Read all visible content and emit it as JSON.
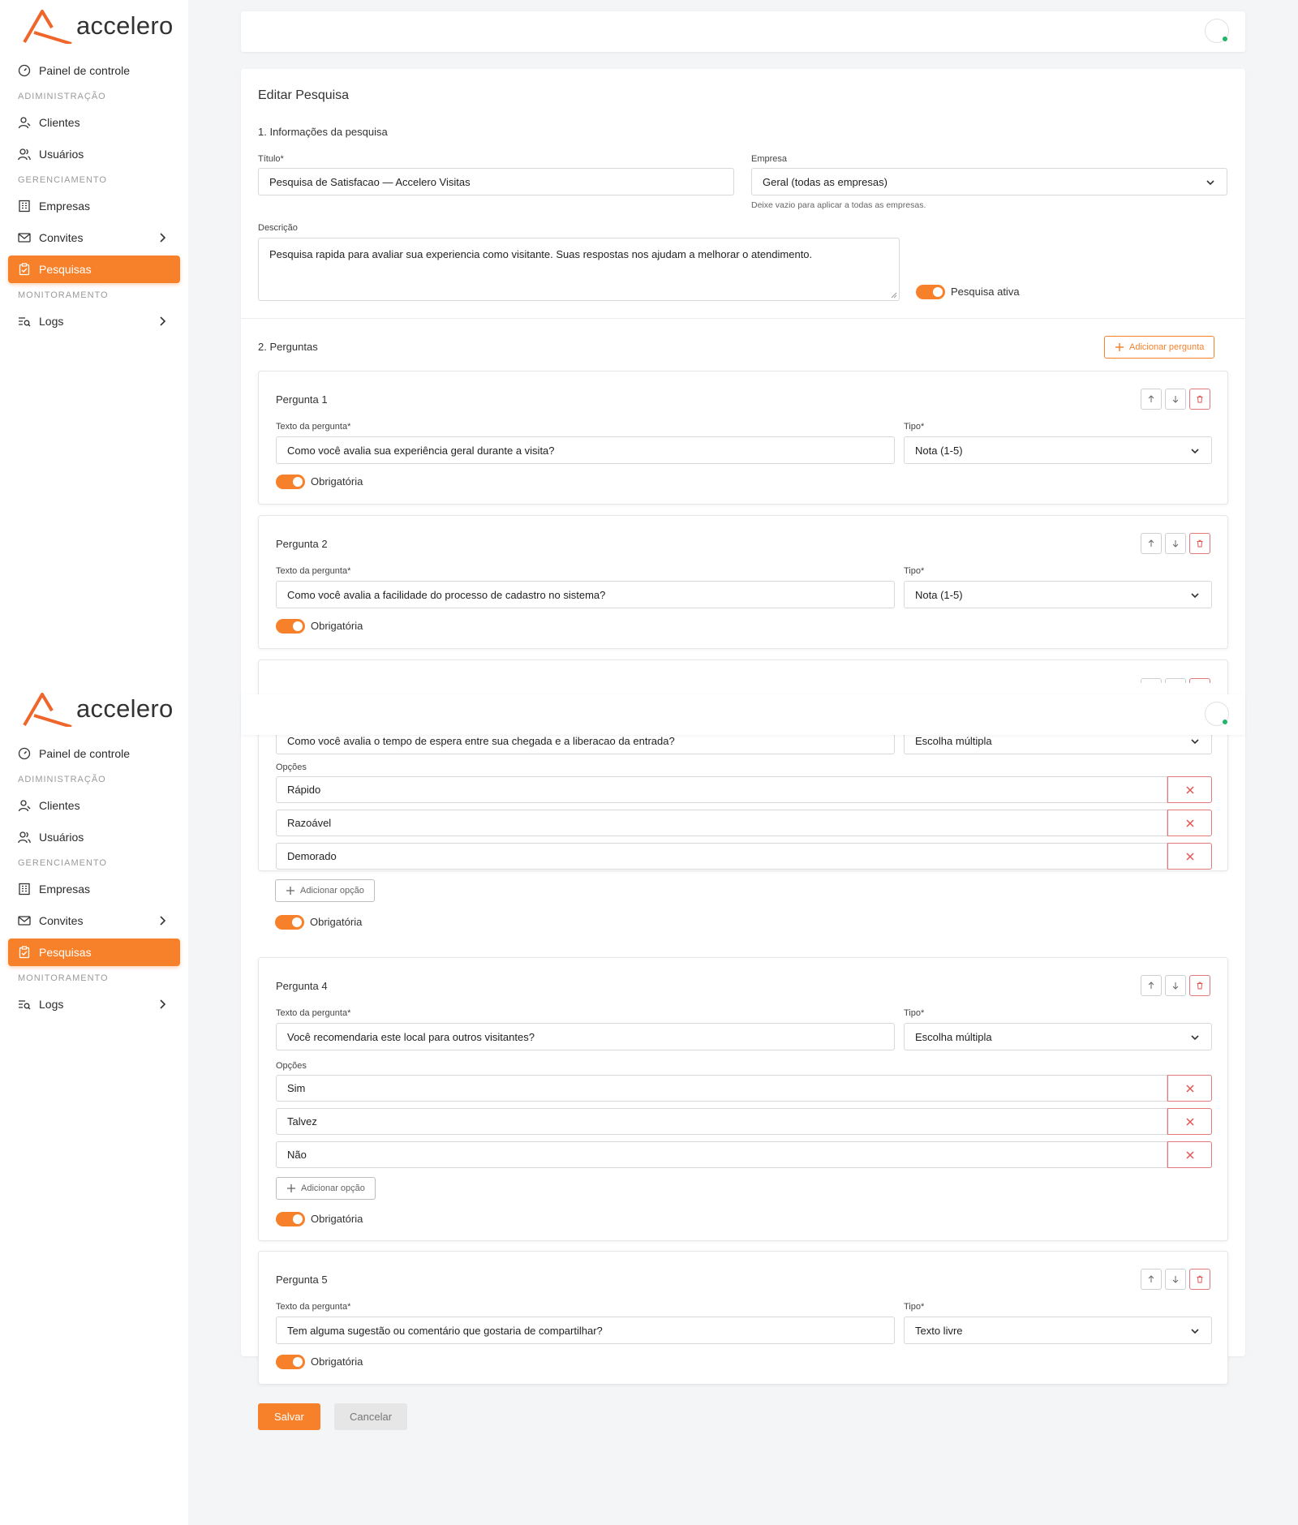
{
  "brand": {
    "name": "accelero",
    "accent": "#f7812b"
  },
  "nav": {
    "dashboard": "Painel de controle",
    "sec_admin": "ADIMINISTRAÇÃO",
    "clients": "Clientes",
    "users": "Usuários",
    "sec_manage": "GERENCIAMENTO",
    "companies": "Empresas",
    "invites": "Convites",
    "surveys": "Pesquisas",
    "sec_monitor": "MONITORAMENTO",
    "logs": "Logs"
  },
  "form": {
    "page_title": "Editar Pesquisa",
    "section1": "1. Informações da pesquisa",
    "title_label": "Título*",
    "title_value": "Pesquisa de Satisfacao — Accelero Visitas",
    "company_label": "Empresa",
    "company_value": "Geral (todas as empresas)",
    "company_help": "Deixe vazio para aplicar a todas as empresas.",
    "desc_label": "Descrição",
    "desc_value": "Pesquisa rapida para avaliar sua experiencia como visitante. Suas respostas nos ajudam a melhorar o atendimento.",
    "active_label": "Pesquisa ativa",
    "section2": "2. Perguntas",
    "add_question": "Adicionar pergunta"
  },
  "common": {
    "text_label": "Texto da pergunta*",
    "type_label": "Tipo*",
    "options_label": "Opções",
    "add_option": "Adicionar opção",
    "required": "Obrigatória"
  },
  "questions": [
    {
      "title": "Pergunta 1",
      "text": "Como você avalia sua experiência geral durante a visita?",
      "type": "Nota (1-5)",
      "required": true
    },
    {
      "title": "Pergunta 2",
      "text": "Como você avalia a facilidade do processo de cadastro no sistema?",
      "type": "Nota (1-5)",
      "required": true
    },
    {
      "text": "Como você avalia o tempo de espera entre sua chegada e a liberacao da entrada?",
      "type": "Escolha múltipla",
      "options": [
        "Rápido",
        "Razoável",
        "Demorado"
      ],
      "required": true
    },
    {
      "title": "Pergunta 4",
      "text": "Você recomendaria este local para outros visitantes?",
      "type": "Escolha múltipla",
      "options": [
        "Sim",
        "Talvez",
        "Não"
      ],
      "required": true
    },
    {
      "title": "Pergunta 5",
      "text": "Tem alguma sugestão ou comentário que gostaria de compartilhar?",
      "type": "Texto livre",
      "required": true
    }
  ],
  "actions": {
    "save": "Salvar",
    "cancel": "Cancelar"
  }
}
